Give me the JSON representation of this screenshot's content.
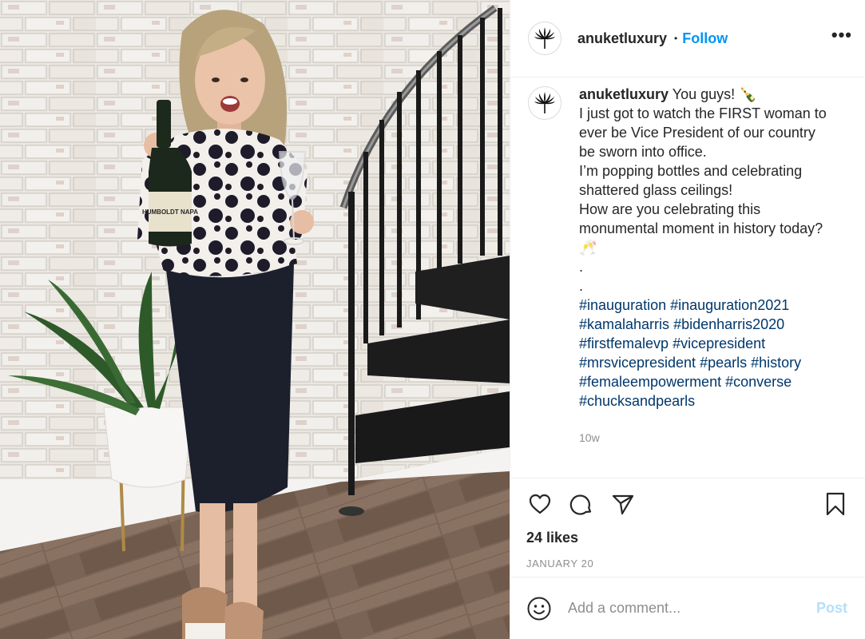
{
  "header": {
    "username": "anuketluxury",
    "separator": "•",
    "follow_label": "Follow",
    "more_label": "•••"
  },
  "photo": {
    "bottle_label": "HUMBOLDT NAPA"
  },
  "caption": {
    "username": "anuketluxury",
    "lines": [
      "You guys! 🍾",
      "I just got to watch the FIRST woman to",
      "ever be Vice President of our country",
      "be sworn into office.",
      "I’m popping bottles and celebrating",
      "shattered glass ceilings!",
      "How are you celebrating this",
      "monumental moment in history today?",
      "🥂",
      ".",
      "."
    ],
    "hashtag_lines": [
      [
        "#inauguration",
        "#inauguration2021"
      ],
      [
        "#kamalaharris",
        "#bidenharris2020"
      ],
      [
        "#firstfemalevp",
        "#vicepresident"
      ],
      [
        "#mrsvicepresident",
        "#pearls",
        "#history"
      ],
      [
        "#femaleempowerment",
        "#converse"
      ],
      [
        "#chucksandpearls"
      ]
    ],
    "time_ago": "10w"
  },
  "actions": {
    "like_icon": "heart-icon",
    "comment_icon": "comment-icon",
    "share_icon": "paper-plane-icon",
    "save_icon": "bookmark-icon",
    "likes_text": "24 likes",
    "date": "JANUARY 20"
  },
  "comment_box": {
    "emoji_icon": "smiley-icon",
    "placeholder": "Add a comment...",
    "post_label": "Post"
  },
  "colors": {
    "link_blue": "#0095f6",
    "hashtag_blue": "#00376b",
    "post_disabled": "#b2dffc",
    "muted": "#8e8e8e",
    "text": "#262626"
  }
}
